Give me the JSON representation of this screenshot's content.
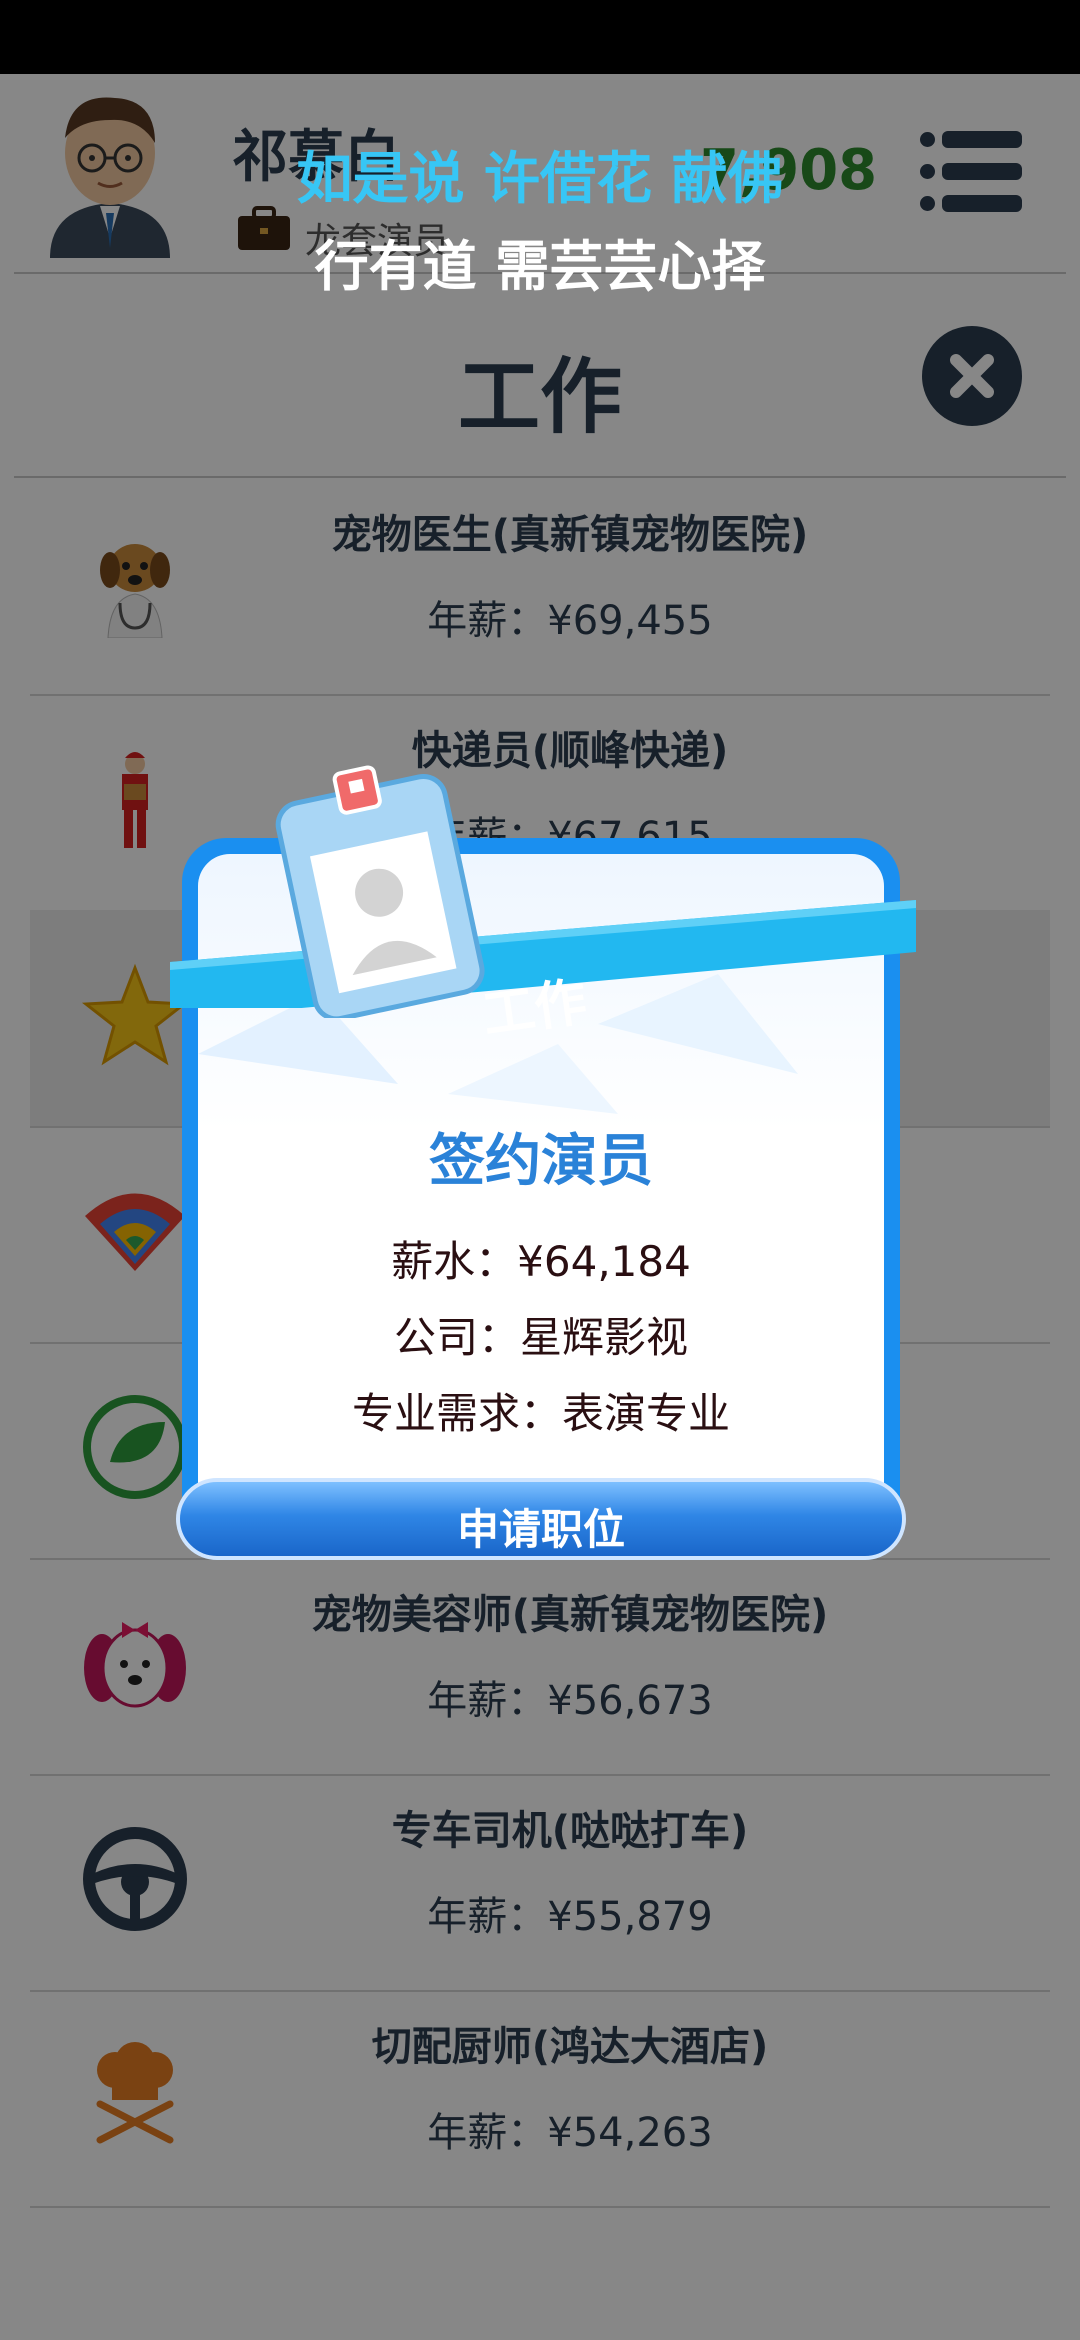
{
  "header": {
    "player_name": "祁慕白",
    "player_job": "龙套演员",
    "money": "7,908"
  },
  "lyrics": {
    "line1": "如是说 许借花 献佛",
    "line2": "行有道 需芸芸心择"
  },
  "page_title": "工作",
  "jobs": [
    {
      "title": "宠物医生(真新镇宠物医院)",
      "salary": "年薪：¥69,455",
      "icon": "vet-dog-icon"
    },
    {
      "title": "快递员(顺峰快递)",
      "salary": "年薪：¥67,615",
      "icon": "courier-icon"
    },
    {
      "title": "",
      "salary": "",
      "icon": "star-icon"
    },
    {
      "title": "",
      "salary": "",
      "icon": "wifi-icon"
    },
    {
      "title": "",
      "salary": "",
      "icon": "leaf-icon"
    },
    {
      "title": "宠物美容师(真新镇宠物医院)",
      "salary": "年薪：¥56,673",
      "icon": "pet-dog-icon"
    },
    {
      "title": "专车司机(哒哒打车)",
      "salary": "年薪：¥55,879",
      "icon": "steering-wheel-icon"
    },
    {
      "title": "切配厨师(鸿达大酒店)",
      "salary": "年薪：¥54,263",
      "icon": "chef-hat-icon"
    }
  ],
  "dialog": {
    "header": "工作",
    "job_name": "签约演员",
    "salary": "薪水：¥64,184",
    "company": "公司：星辉影视",
    "requirement": "专业需求：表演专业",
    "apply_label": "申请职位"
  },
  "colors": {
    "accent_blue": "#2a82d8",
    "ribbon": "#22b8f0",
    "money_green": "#2e8b2e",
    "dark_navy": "#2c3e50"
  }
}
